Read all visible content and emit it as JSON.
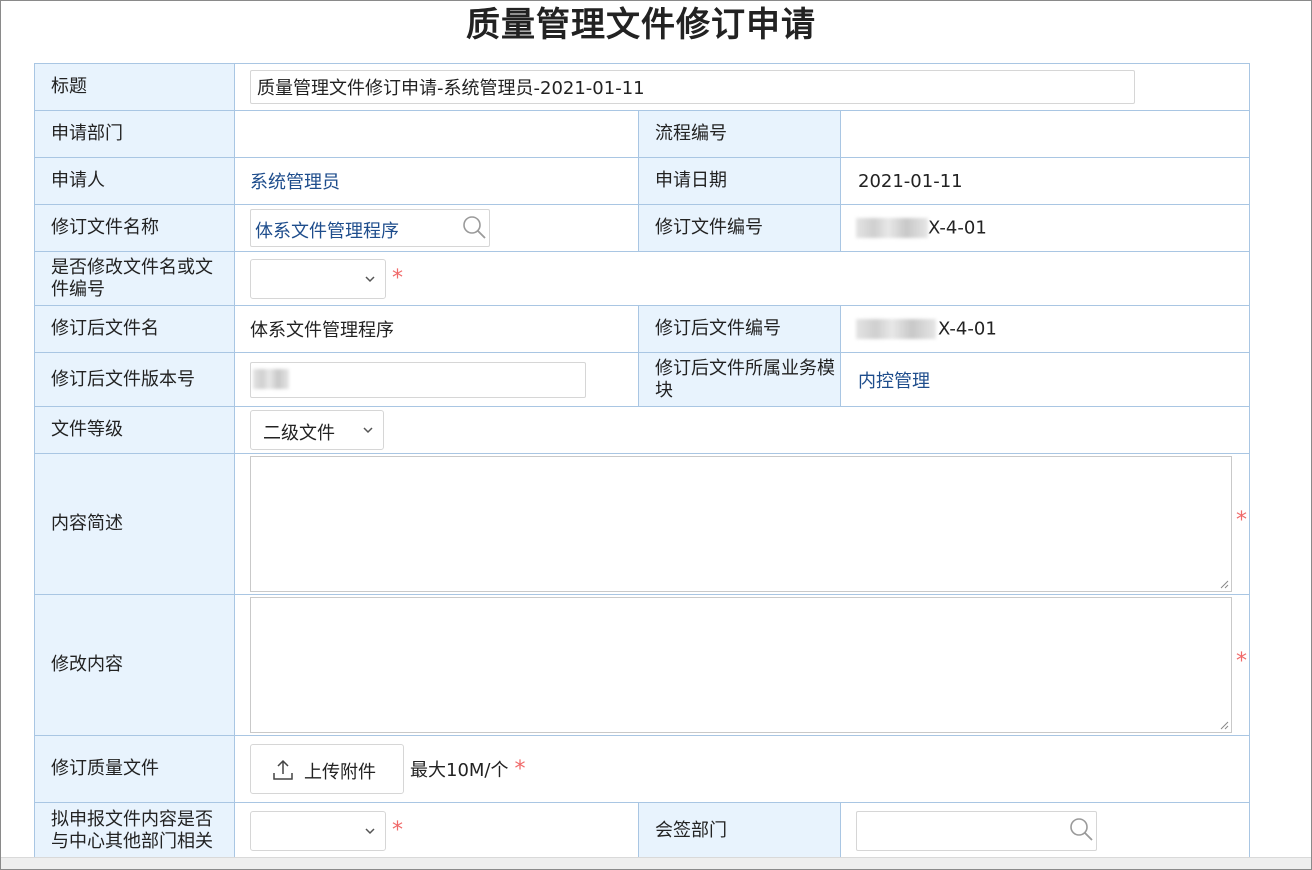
{
  "page": {
    "title": "质量管理文件修订申请"
  },
  "form": {
    "title_label": "标题",
    "title_value": "质量管理文件修订申请-系统管理员-2021-01-11",
    "department_label": "申请部门",
    "department_value": "",
    "process_no_label": "流程编号",
    "process_no_value": "",
    "applicant_label": "申请人",
    "applicant_value": "系统管理员",
    "apply_date_label": "申请日期",
    "apply_date_value": "2021-01-11",
    "revise_file_name_label": "修订文件名称",
    "revise_file_name_value": "体系文件管理程序",
    "revise_file_no_label": "修订文件编号",
    "revise_file_no_value": "X-4-01",
    "change_name_label": "是否修改文件名或文件编号",
    "change_name_value": "",
    "new_file_name_label": "修订后文件名",
    "new_file_name_value": "体系文件管理程序",
    "new_file_no_label": "修订后文件编号",
    "new_file_no_value": "X-4-01",
    "new_version_label": "修订后文件版本号",
    "new_version_value": "",
    "module_label": "修订后文件所属业务模块",
    "module_value": "内控管理",
    "file_level_label": "文件等级",
    "file_level_value": "二级文件",
    "summary_label": "内容简述",
    "summary_value": "",
    "changes_label": "修改内容",
    "changes_value": "",
    "quality_file_label": "修订质量文件",
    "upload_button_label": "上传附件",
    "upload_hint": "最大10M/个",
    "related_label": "拟申报文件内容是否与中心其他部门相关",
    "related_value": "",
    "countersign_label": "会签部门",
    "countersign_value": "",
    "required_mark": "*"
  },
  "icons": {
    "search": "magnifier-icon",
    "dropdown": "chevron-down-icon",
    "upload": "upload-icon",
    "resize": "resize-grip-icon"
  },
  "colors": {
    "label_bg": "#e8f3fd",
    "border": "#a9c6e3",
    "link": "#1e4d8c",
    "required": "#f06a6a"
  }
}
